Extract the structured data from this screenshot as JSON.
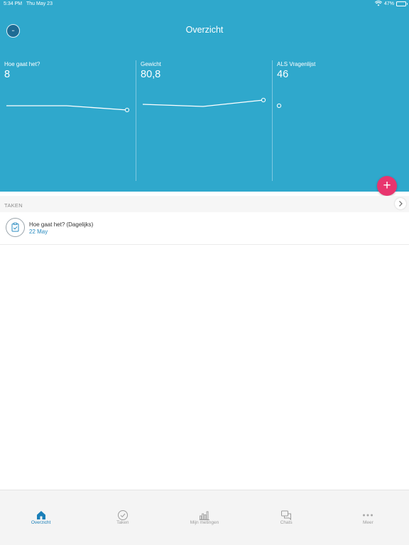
{
  "status_bar": {
    "time": "5:34 PM",
    "date": "Thu May 23",
    "battery": "47%",
    "battery_level": 0.47
  },
  "header": {
    "title": "Overzicht",
    "avatar_initials": "••",
    "background": "#2fa8cc"
  },
  "metrics": [
    {
      "label": "Hoe gaat het?",
      "value": "8",
      "trend": [
        8.4,
        8.4,
        8.0
      ],
      "trend_range": [
        6,
        10
      ]
    },
    {
      "label": "Gewicht",
      "value": "80,8",
      "trend": [
        79.6,
        79.0,
        80.8
      ],
      "trend_range": [
        72,
        84
      ]
    },
    {
      "label": "ALS Vragenlijst",
      "value": "46",
      "trend": [
        46
      ],
      "trend_range": [
        40,
        50
      ]
    }
  ],
  "fab": {
    "label": "+",
    "color": "#e8356e"
  },
  "tasks_section": {
    "title": "TAKEN",
    "items": [
      {
        "name": "Hoe gaat het? (Dagelijks)",
        "date": "22 May",
        "icon": "clipboard-icon"
      }
    ]
  },
  "tabbar": {
    "active_color": "#1a7fb8",
    "tabs": [
      {
        "label": "Overzicht",
        "icon": "home-icon",
        "active": true
      },
      {
        "label": "Taken",
        "icon": "checkmark-circle-icon",
        "active": false
      },
      {
        "label": "Mijn metingen",
        "icon": "bar-chart-icon",
        "active": false
      },
      {
        "label": "Chats",
        "icon": "chat-bubbles-icon",
        "active": false
      },
      {
        "label": "Meer",
        "icon": "more-dots-icon",
        "active": false
      }
    ]
  }
}
